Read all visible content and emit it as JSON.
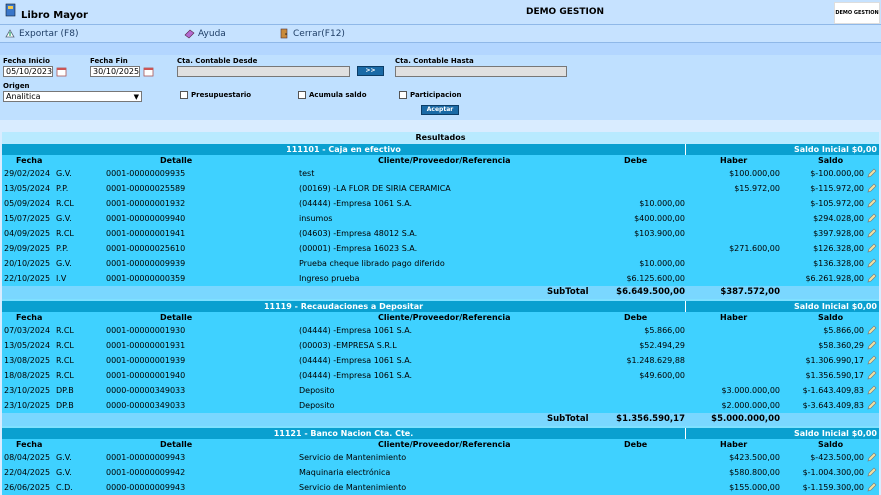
{
  "app": {
    "title": "Libro Mayor",
    "company": "DEMO GESTION",
    "logo_text": "DEMO GESTION"
  },
  "toolbar": {
    "export": "Exportar (F8)",
    "help": "Ayuda",
    "close": "Cerrar(F12)"
  },
  "filters": {
    "fecha_inicio_label": "Fecha Inicio",
    "fecha_inicio": "05/10/2023",
    "fecha_fin_label": "Fecha Fin",
    "fecha_fin": "30/10/2025",
    "desde_label": "Cta. Contable Desde",
    "desde": "",
    "go": ">>",
    "hasta_label": "Cta. Contable Hasta",
    "hasta": "",
    "origen_label": "Origen",
    "origen": "Analitica",
    "presupuestario": "Presupuestario",
    "acumula": "Acumula saldo",
    "participacion": "Participacion",
    "aceptar": "Aceptar"
  },
  "results_title": "Resultados",
  "columns": {
    "fecha": "Fecha",
    "detalle": "Detalle",
    "cliente": "Cliente/Proveedor/Referencia",
    "debe": "Debe",
    "haber": "Haber",
    "saldo": "Saldo"
  },
  "sections": [
    {
      "name": "111101 - Caja en efectivo",
      "saldo_inicial": "Saldo Inicial $0,00",
      "rows": [
        [
          "29/02/2024",
          "G.V.",
          "0001-00000009935",
          "test",
          "",
          "$100.000,00",
          "$-100.000,00"
        ],
        [
          "13/05/2024",
          "P.P.",
          "0001-00000025589",
          "(00169) -LA FLOR DE SIRIA CERAMICA",
          "",
          "$15.972,00",
          "$-115.972,00"
        ],
        [
          "05/09/2024",
          "R.CL",
          "0001-00000001932",
          "(04444) -Empresa 1061 S.A.",
          "$10.000,00",
          "",
          "$-105.972,00"
        ],
        [
          "15/07/2025",
          "G.V.",
          "0001-00000009940",
          "insumos",
          "$400.000,00",
          "",
          "$294.028,00"
        ],
        [
          "04/09/2025",
          "R.CL",
          "0001-00000001941",
          "(04603) -Empresa 48012 S.A.",
          "$103.900,00",
          "",
          "$397.928,00"
        ],
        [
          "29/09/2025",
          "P.P.",
          "0001-00000025610",
          "(00001) -Empresa 16023 S.A.",
          "",
          "$271.600,00",
          "$126.328,00"
        ],
        [
          "20/10/2025",
          "G.V.",
          "0001-00000009939",
          "Prueba cheque librado pago diferido",
          "$10.000,00",
          "",
          "$136.328,00"
        ],
        [
          "22/10/2025",
          "I.V",
          "0001-00000000359",
          "Ingreso prueba",
          "$6.125.600,00",
          "",
          "$6.261.928,00"
        ]
      ],
      "subtotal_label": "SubTotal",
      "subtotal_debe": "$6.649.500,00",
      "subtotal_haber": "$387.572,00"
    },
    {
      "name": "11119 - Recaudaciones a Depositar",
      "saldo_inicial": "Saldo Inicial $0,00",
      "rows": [
        [
          "07/03/2024",
          "R.CL",
          "0001-00000001930",
          "(04444) -Empresa 1061 S.A.",
          "$5.866,00",
          "",
          "$5.866,00"
        ],
        [
          "13/05/2024",
          "R.CL",
          "0001-00000001931",
          "(00003) -EMPRESA S.R.L",
          "$52.494,29",
          "",
          "$58.360,29"
        ],
        [
          "13/08/2025",
          "R.CL",
          "0001-00000001939",
          "(04444) -Empresa 1061 S.A.",
          "$1.248.629,88",
          "",
          "$1.306.990,17"
        ],
        [
          "18/08/2025",
          "R.CL",
          "0001-00000001940",
          "(04444) -Empresa 1061 S.A.",
          "$49.600,00",
          "",
          "$1.356.590,17"
        ],
        [
          "23/10/2025",
          "DP.B",
          "0000-00000349033",
          "Deposito",
          "",
          "$3.000.000,00",
          "$-1.643.409,83"
        ],
        [
          "23/10/2025",
          "DP.B",
          "0000-00000349033",
          "Deposito",
          "",
          "$2.000.000,00",
          "$-3.643.409,83"
        ]
      ],
      "subtotal_label": "SubTotal",
      "subtotal_debe": "$1.356.590,17",
      "subtotal_haber": "$5.000.000,00"
    },
    {
      "name": "11121 - Banco Nacion Cta. Cte.",
      "saldo_inicial": "Saldo Inicial $0,00",
      "rows": [
        [
          "08/04/2025",
          "G.V.",
          "0001-00000009943",
          "Servicio de Mantenimiento",
          "",
          "$423.500,00",
          "$-423.500,00"
        ],
        [
          "22/04/2025",
          "G.V.",
          "0001-00000009942",
          "Maquinaria electrónica",
          "",
          "$580.800,00",
          "$-1.004.300,00"
        ],
        [
          "26/06/2025",
          "C.D.",
          "0000-00000009943",
          "Servicio de Mantenimiento",
          "",
          "$155.000,00",
          "$-1.159.300,00"
        ]
      ]
    }
  ]
}
